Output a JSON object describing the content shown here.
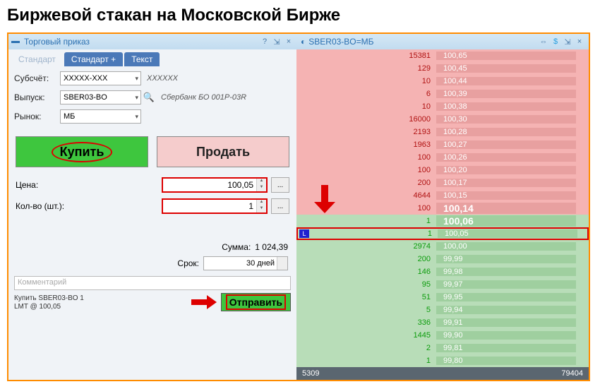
{
  "title": "Биржевой стакан на Московской Бирже",
  "left": {
    "window_title": "Торговый приказ",
    "tabs": [
      "Стандарт",
      "Стандарт +",
      "Текст"
    ],
    "fields": {
      "subacct_label": "Субсчёт:",
      "subacct_value": "XXXXX-XXX",
      "subacct_desc": "XXXXXX",
      "issue_label": "Выпуск:",
      "issue_value": "SBER03-BO",
      "issue_desc": "Сбербанк БО 001P-03R",
      "market_label": "Рынок:",
      "market_value": "МБ"
    },
    "buy_label": "Купить",
    "sell_label": "Продать",
    "price_label": "Цена:",
    "price_value": "100,05",
    "qty_label": "Кол-во (шт.):",
    "qty_value": "1",
    "sum_label": "Сумма:",
    "sum_value": "1 024,39",
    "term_label": "Срок:",
    "term_value": "30 дней",
    "comment_placeholder": "Комментарий",
    "order_info_line1": "Купить SBER03-BO 1",
    "order_info_line2": "LMT @ 100,05",
    "send_label": "Отправить"
  },
  "right": {
    "header": "SBER03-BO=МБ",
    "asks": [
      {
        "vol": "15381",
        "price": "100,65"
      },
      {
        "vol": "129",
        "price": "100,45"
      },
      {
        "vol": "10",
        "price": "100,44"
      },
      {
        "vol": "6",
        "price": "100,39"
      },
      {
        "vol": "10",
        "price": "100,38"
      },
      {
        "vol": "16000",
        "price": "100,30"
      },
      {
        "vol": "2193",
        "price": "100,28"
      },
      {
        "vol": "1963",
        "price": "100,27"
      },
      {
        "vol": "100",
        "price": "100,26"
      },
      {
        "vol": "100",
        "price": "100,20"
      },
      {
        "vol": "200",
        "price": "100,17"
      },
      {
        "vol": "4644",
        "price": "100,15"
      },
      {
        "vol": "100",
        "price": "100,14"
      }
    ],
    "best_bid": {
      "vol": "1",
      "price": "100,06"
    },
    "marked": {
      "vol": "1",
      "price": "100,05"
    },
    "bids": [
      {
        "vol": "2974",
        "price": "100,00"
      },
      {
        "vol": "200",
        "price": "99,99"
      },
      {
        "vol": "146",
        "price": "99,98"
      },
      {
        "vol": "95",
        "price": "99,97"
      },
      {
        "vol": "51",
        "price": "99,95"
      },
      {
        "vol": "5",
        "price": "99,94"
      },
      {
        "vol": "336",
        "price": "99,91"
      },
      {
        "vol": "1445",
        "price": "99,90"
      },
      {
        "vol": "2",
        "price": "99,81"
      },
      {
        "vol": "1",
        "price": "99,80"
      }
    ],
    "footer_left": "5309",
    "footer_right": "79404"
  }
}
